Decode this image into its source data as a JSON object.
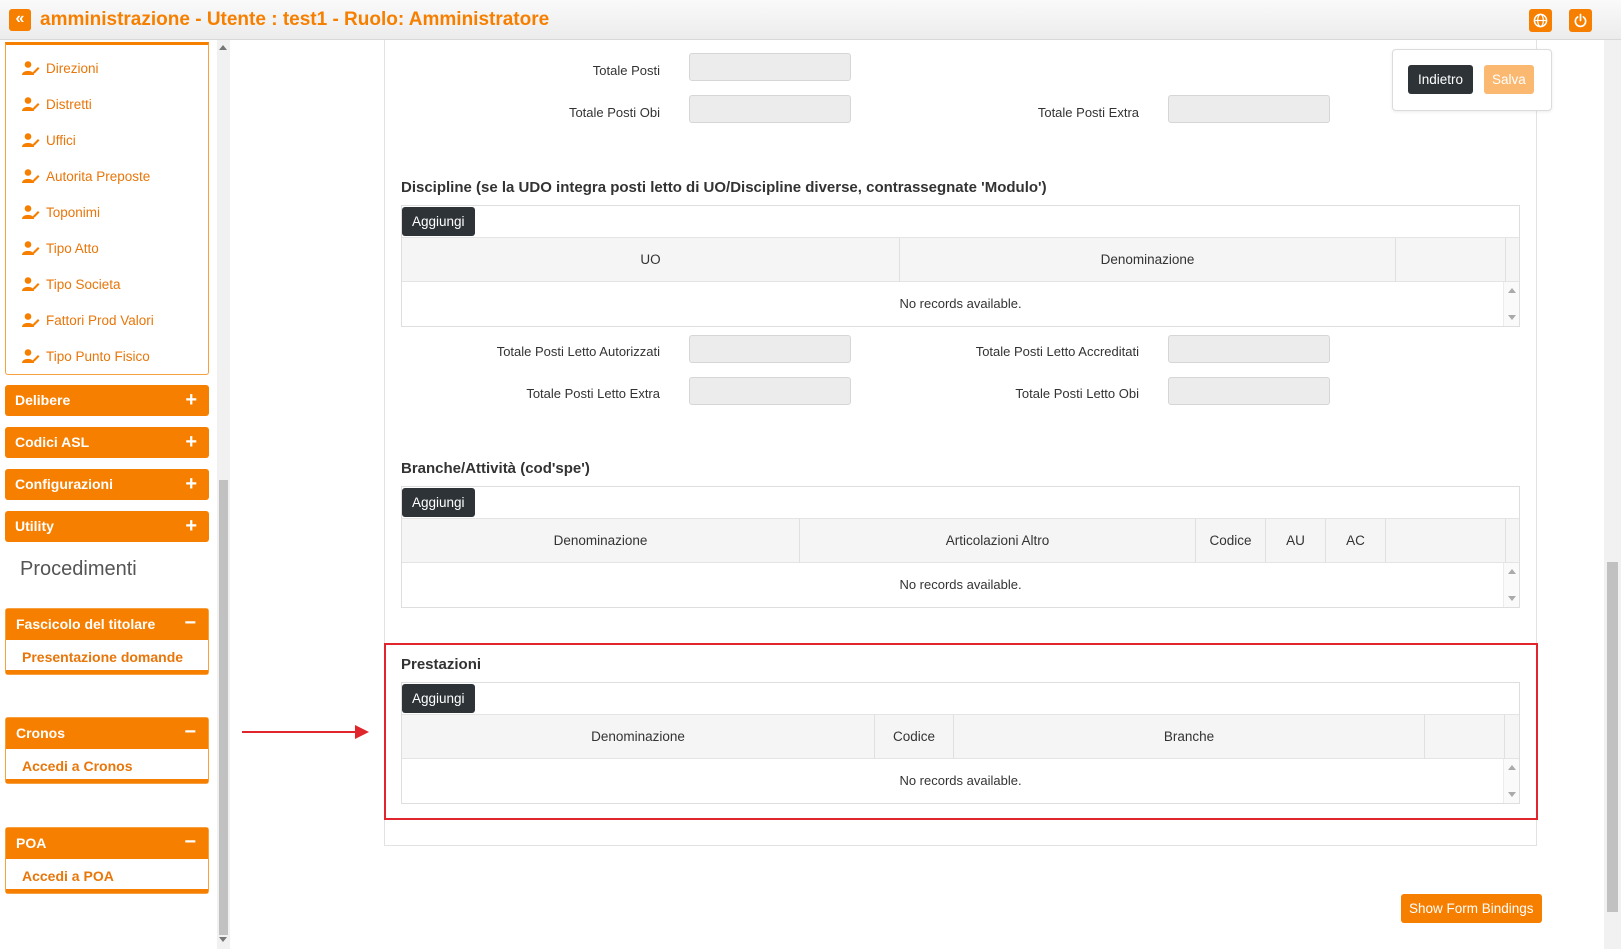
{
  "header": {
    "title": "amministrazione - Utente : test1 - Ruolo: Amministratore",
    "collapse_icon": "double-chevron-left-icon",
    "language_icon": "globe-icon",
    "logout_icon": "power-icon",
    "accent_color": "#f77f00"
  },
  "sidebar": {
    "submenu_items": [
      {
        "label": "Direzioni",
        "icon": "user-edit-icon"
      },
      {
        "label": "Distretti",
        "icon": "user-edit-icon"
      },
      {
        "label": "Uffici",
        "icon": "user-edit-icon"
      },
      {
        "label": "Autorita Preposte",
        "icon": "user-edit-icon"
      },
      {
        "label": "Toponimi",
        "icon": "user-edit-icon"
      },
      {
        "label": "Tipo Atto",
        "icon": "user-edit-icon"
      },
      {
        "label": "Tipo Societa",
        "icon": "user-edit-icon"
      },
      {
        "label": "Fattori Prod Valori",
        "icon": "user-edit-icon"
      },
      {
        "label": "Tipo Punto Fisico",
        "icon": "user-edit-icon"
      }
    ],
    "menus": [
      {
        "label": "Delibere",
        "sign": "+"
      },
      {
        "label": "Codici ASL",
        "sign": "+"
      },
      {
        "label": "Configurazioni",
        "sign": "+"
      },
      {
        "label": "Utility",
        "sign": "+"
      }
    ],
    "section_title": "Procedimenti",
    "groups": [
      {
        "label": "Fascicolo del titolare",
        "sign": "−",
        "link": "Presentazione domande"
      },
      {
        "label": "Cronos",
        "sign": "−",
        "link": "Accedi a Cronos"
      },
      {
        "label": "POA",
        "sign": "−",
        "link": "Accedi a POA"
      }
    ]
  },
  "form": {
    "totale_posti_label": "Totale Posti",
    "totale_posti_obi_label": "Totale Posti Obi",
    "totale_posti_extra_label": "Totale Posti Extra",
    "totale_posti_value": "",
    "totale_posti_obi_value": "",
    "totale_posti_extra_value": "",
    "discipline": {
      "title": "Discipline (se la UDO integra posti letto di UO/Discipline diverse, contrassegnate 'Modulo')",
      "add_label": "Aggiungi",
      "columns": [
        "UO",
        "Denominazione"
      ],
      "empty_text": "No records available."
    },
    "letto": {
      "autorizzati_label": "Totale Posti Letto Autorizzati",
      "accreditati_label": "Totale Posti Letto Accreditati",
      "extra_label": "Totale Posti Letto Extra",
      "obi_label": "Totale Posti Letto Obi",
      "autorizzati_value": "",
      "accreditati_value": "",
      "extra_value": "",
      "obi_value": ""
    },
    "branche": {
      "title": "Branche/Attività (cod'spe')",
      "add_label": "Aggiungi",
      "columns": [
        "Denominazione",
        "Articolazioni Altro",
        "Codice",
        "AU",
        "AC"
      ],
      "empty_text": "No records available."
    },
    "prestazioni": {
      "title": "Prestazioni",
      "add_label": "Aggiungi",
      "columns": [
        "Denominazione",
        "Codice",
        "Branche"
      ],
      "empty_text": "No records available."
    }
  },
  "actions": {
    "back_label": "Indietro",
    "save_label": "Salva",
    "bindings_label": "Show Form Bindings"
  },
  "annotation": {
    "highlight_color": "#e0262c"
  }
}
